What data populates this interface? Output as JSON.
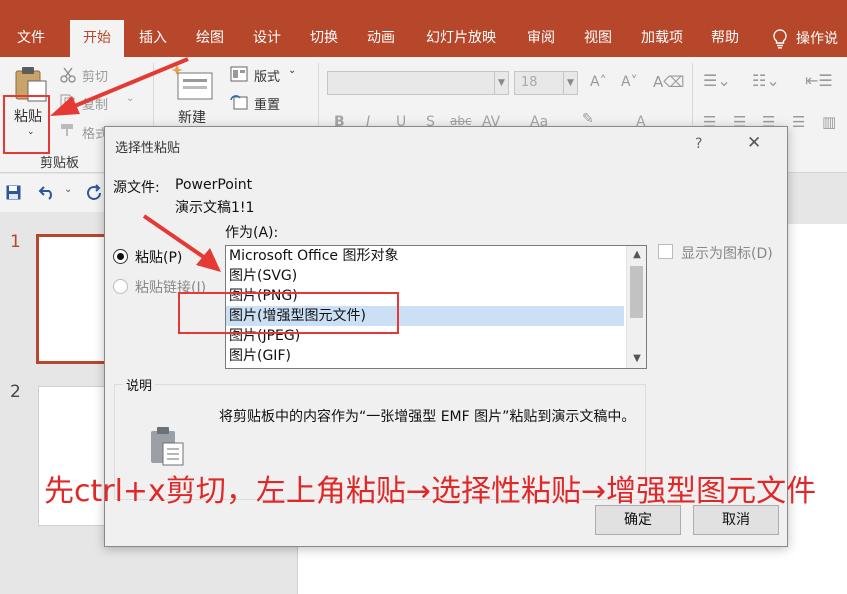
{
  "ribbon_tabs": [
    {
      "label": "文件"
    },
    {
      "label": "开始"
    },
    {
      "label": "插入"
    },
    {
      "label": "绘图"
    },
    {
      "label": "设计"
    },
    {
      "label": "切换"
    },
    {
      "label": "动画"
    },
    {
      "label": "幻灯片放映"
    },
    {
      "label": "审阅"
    },
    {
      "label": "视图"
    },
    {
      "label": "加载项"
    },
    {
      "label": "帮助"
    },
    {
      "label": "操作说"
    }
  ],
  "active_tab": "开始",
  "ribbon": {
    "paste": "粘贴",
    "cut": "剪切",
    "copy": "复制",
    "format_painter": "格式",
    "clipboard_group": "剪贴板",
    "new_slide": "新建",
    "layout": "版式",
    "reset": "重置",
    "font_size": "18",
    "format_letters": [
      "B",
      "I",
      "U",
      "S",
      "abc",
      "AV",
      "Aa",
      "A"
    ]
  },
  "slides_pane": {
    "slide_numbers": [
      "1",
      "2"
    ]
  },
  "dialog": {
    "title": "选择性粘贴",
    "help": "?",
    "close": "✕",
    "source_label": "源文件:",
    "source_app": "PowerPoint",
    "source_doc": "演示文稿1!1",
    "as_label": "作为(A):",
    "paste_option": "粘贴(P)",
    "paste_link_option": "粘贴链接(I)",
    "display_as_icon": "显示为图标(D)",
    "as_items": [
      "Microsoft Office 图形对象",
      "图片(SVG)",
      "图片(PNG)",
      "图片(增强型图元文件)",
      "图片(JPEG)",
      "图片(GIF)"
    ],
    "selected_index": 3,
    "description_title": "说明",
    "description_text": "将剪贴板中的内容作为“一张增强型 EMF 图片”粘贴到演示文稿中。",
    "ok": "确定",
    "cancel": "取消"
  },
  "annotation": {
    "caption": "先ctrl+x剪切，左上角粘贴→选择性粘贴→增强型图元文件",
    "color": "#e02828"
  },
  "colors": {
    "accent": "#b7472a",
    "selection": "#cce0f5",
    "slide_selected_border": "#b7472a"
  }
}
